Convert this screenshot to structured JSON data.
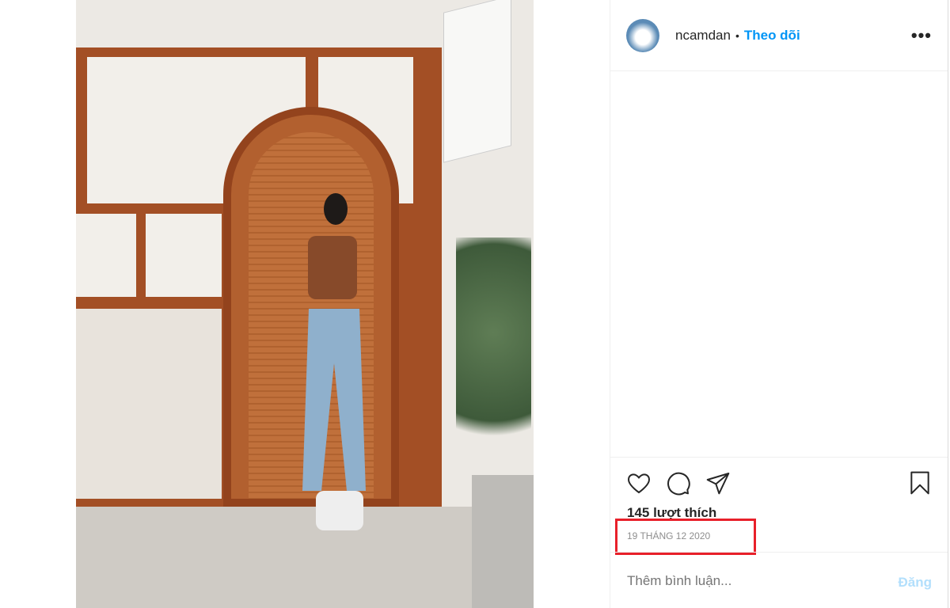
{
  "post": {
    "username": "ncamdan",
    "separator": "•",
    "follow_label": "Theo dõi",
    "more_label": "•••",
    "likes": "145 lượt thích",
    "date": "19 THÁNG 12 2020",
    "comment_placeholder": "Thêm bình luận...",
    "post_label": "Đăng"
  },
  "colors": {
    "accent": "#0095f6",
    "highlight": "#e8202a"
  }
}
